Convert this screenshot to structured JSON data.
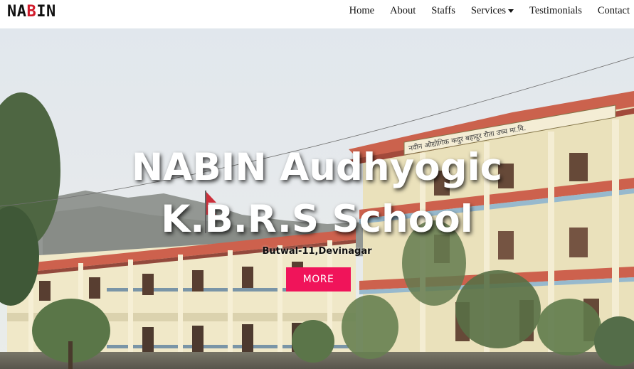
{
  "brand": {
    "prefix": "NA",
    "accent": "B",
    "suffix": "IN"
  },
  "nav": {
    "home": "Home",
    "about": "About",
    "staffs": "Staffs",
    "services": "Services",
    "testimonials": "Testimonials",
    "contact": "Contact"
  },
  "hero": {
    "title_line1": "NABIN Audhyogic",
    "title_line2": "K.B.R.S School",
    "subtitle": "Butwal-11,Devinagar",
    "button_label": "MORE",
    "building_sign": "नवीन औद्योगिक कदुर बहादुर रौता उच्च मा.वि."
  },
  "colors": {
    "accent": "#d11a2a",
    "button": "#f0145a",
    "roof": "#c9543e",
    "wall": "#efe6c4"
  }
}
